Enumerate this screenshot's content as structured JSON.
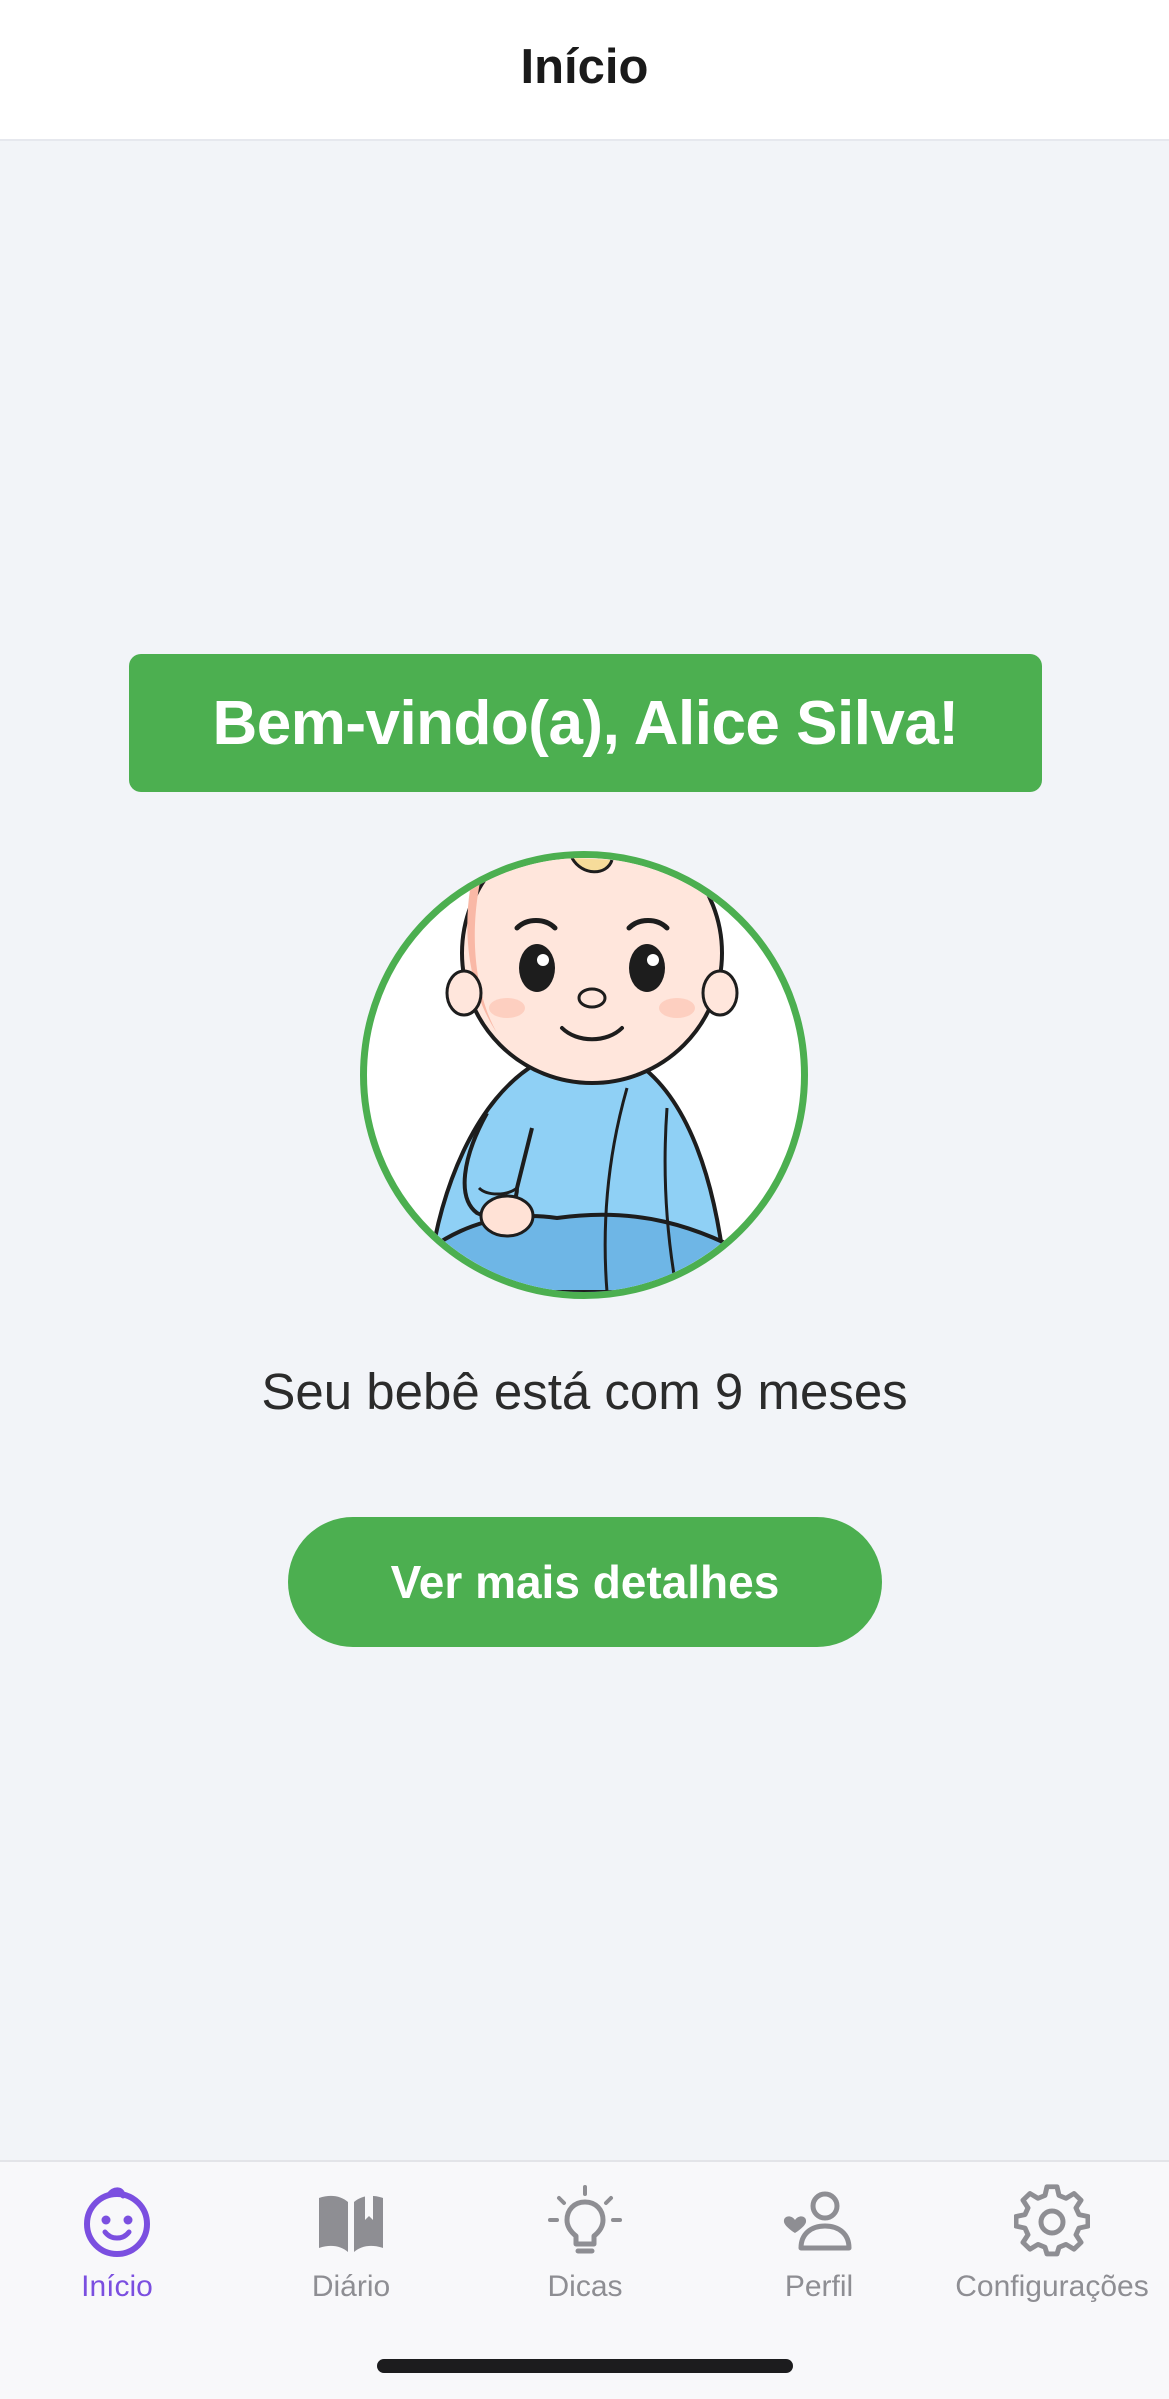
{
  "header": {
    "title": "Início"
  },
  "main": {
    "welcome": "Bem-vindo(a), Alice Silva!",
    "avatar_icon": "baby-illustration",
    "age_text": "Seu bebê está com 9 meses",
    "details_button": "Ver mais detalhes"
  },
  "tabs": [
    {
      "label": "Início",
      "icon": "baby-face-icon",
      "active": true
    },
    {
      "label": "Diário",
      "icon": "open-book-icon",
      "active": false
    },
    {
      "label": "Dicas",
      "icon": "lightbulb-icon",
      "active": false
    },
    {
      "label": "Perfil",
      "icon": "profile-heart-icon",
      "active": false
    },
    {
      "label": "Configurações",
      "icon": "gear-icon",
      "active": false
    }
  ],
  "colors": {
    "accent_green": "#4caf50",
    "active_tab": "#7b4fe0",
    "inactive_tab": "#8e8e93",
    "background": "#f2f4f8"
  }
}
